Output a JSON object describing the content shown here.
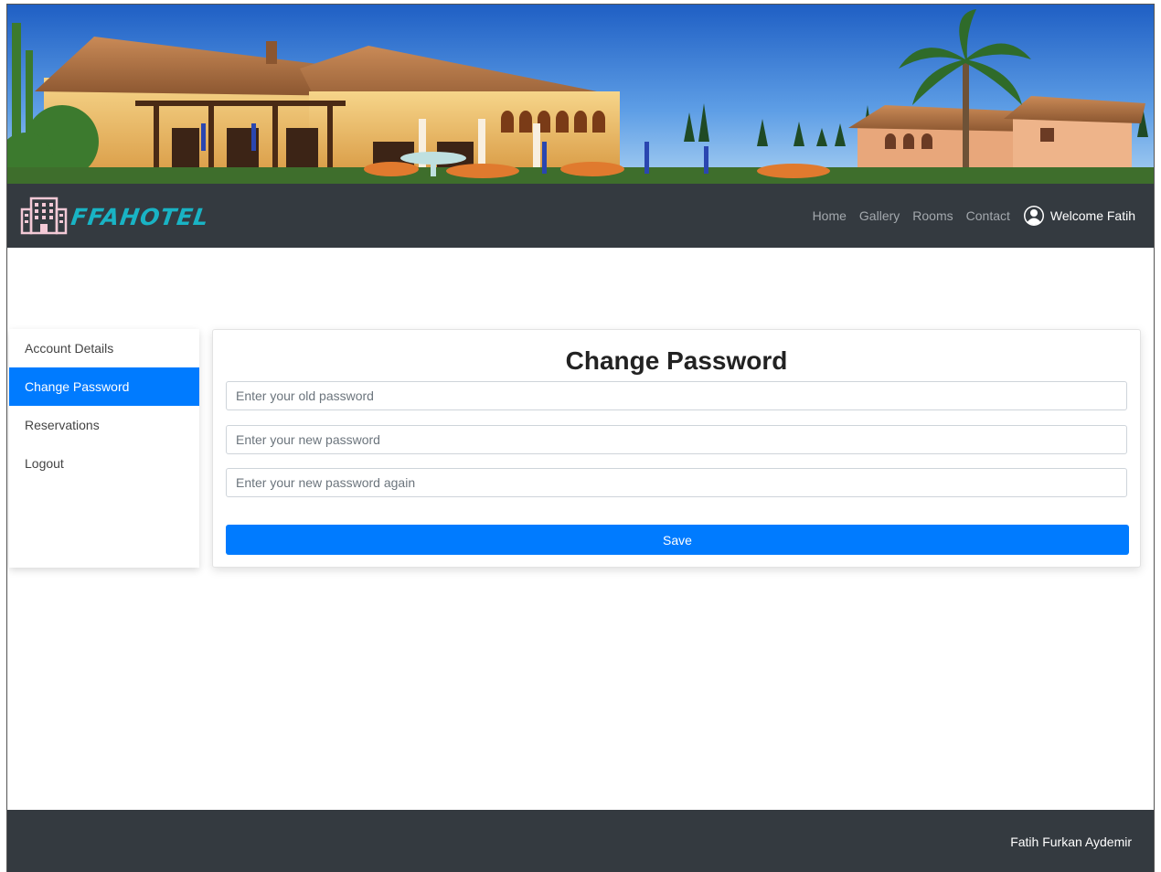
{
  "brand": {
    "name": "FFAHOTEL",
    "logo_icon": "hotel-building-icon",
    "color": "#19b3c4"
  },
  "nav": {
    "links": [
      "Home",
      "Gallery",
      "Rooms",
      "Contact"
    ],
    "user_icon": "user-avatar-icon",
    "welcome": "Welcome Fatih"
  },
  "sidebar": {
    "items": [
      {
        "label": "Account Details",
        "active": false
      },
      {
        "label": "Change Password",
        "active": true
      },
      {
        "label": "Reservations",
        "active": false
      },
      {
        "label": "Logout",
        "active": false
      }
    ]
  },
  "form": {
    "title": "Change Password",
    "old_password_placeholder": "Enter your old password",
    "new_password_placeholder": "Enter your new password",
    "new_password_again_placeholder": "Enter your new password again",
    "save_label": "Save"
  },
  "footer": {
    "text": "Fatih Furkan Aydemir"
  },
  "colors": {
    "navbar": "#343a40",
    "primary": "#007bff",
    "nav_link": "#a3a8ad"
  }
}
